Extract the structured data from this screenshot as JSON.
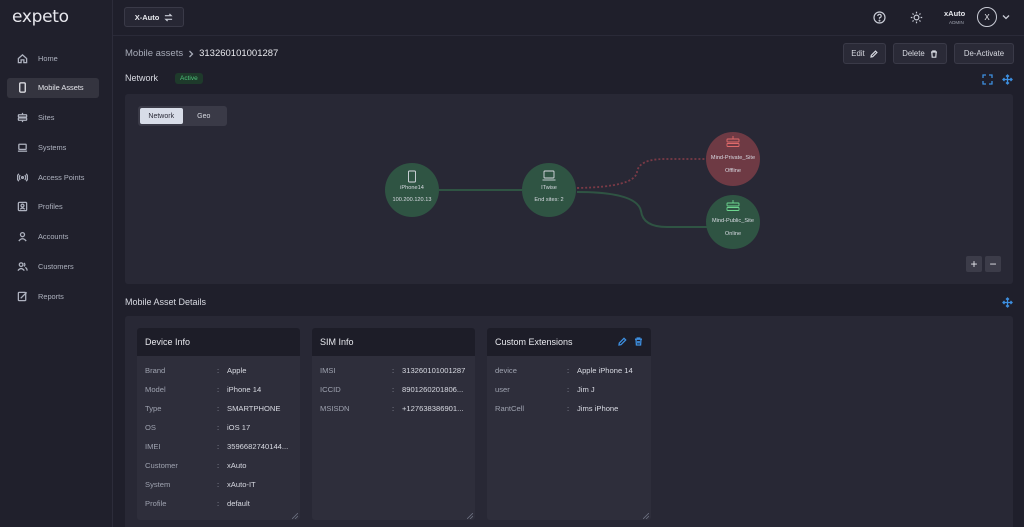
{
  "app": {
    "logo": "expeto"
  },
  "sidebar": {
    "items": [
      {
        "label": "Home",
        "icon": "home-icon"
      },
      {
        "label": "Mobile Assets",
        "icon": "phone-icon"
      },
      {
        "label": "Sites",
        "icon": "site-icon"
      },
      {
        "label": "Systems",
        "icon": "laptop-icon"
      },
      {
        "label": "Access Points",
        "icon": "antenna-icon"
      },
      {
        "label": "Profiles",
        "icon": "profile-icon"
      },
      {
        "label": "Accounts",
        "icon": "user-icon"
      },
      {
        "label": "Customers",
        "icon": "users-icon"
      },
      {
        "label": "Reports",
        "icon": "report-icon"
      }
    ],
    "active": "Mobile Assets"
  },
  "topbar": {
    "tenant": "X-Auto",
    "user_name": "xAuto",
    "user_role": "ADMIN",
    "avatar_letter": "X"
  },
  "header": {
    "breadcrumb_parent": "Mobile assets",
    "breadcrumb_current": "313260101001287",
    "edit_label": "Edit",
    "delete_label": "Delete",
    "deactivate_label": "De-Activate"
  },
  "network": {
    "title": "Network",
    "status": "Active",
    "toggle": {
      "network": "Network",
      "geo": "Geo",
      "selected": "Network"
    },
    "nodes": {
      "device": {
        "name": "iPhone14",
        "detail": "100.200.120.13"
      },
      "hub": {
        "name": "ITwise",
        "detail": "End sites: 2"
      },
      "site_private": {
        "name": "Mind-Private_Site",
        "detail": "Offline"
      },
      "site_public": {
        "name": "Mind-Public_Site",
        "detail": "Online"
      }
    },
    "zoom_in": "+",
    "zoom_out": "−"
  },
  "details": {
    "title": "Mobile Asset Details",
    "device_info": {
      "title": "Device Info",
      "rows": [
        {
          "key": "Brand",
          "value": "Apple"
        },
        {
          "key": "Model",
          "value": "iPhone 14"
        },
        {
          "key": "Type",
          "value": "SMARTPHONE"
        },
        {
          "key": "OS",
          "value": "iOS 17"
        },
        {
          "key": "IMEI",
          "value": "3596682740144..."
        },
        {
          "key": "Customer",
          "value": "xAuto"
        },
        {
          "key": "System",
          "value": "xAuto-IT"
        },
        {
          "key": "Profile",
          "value": "default"
        }
      ]
    },
    "sim_info": {
      "title": "SIM Info",
      "rows": [
        {
          "key": "IMSI",
          "value": "313260101001287"
        },
        {
          "key": "ICCID",
          "value": "8901260201806..."
        },
        {
          "key": "MSISDN",
          "value": "+127638386901..."
        }
      ]
    },
    "custom_extensions": {
      "title": "Custom Extensions",
      "rows": [
        {
          "key": "device",
          "value": "Apple iPhone 14"
        },
        {
          "key": "user",
          "value": "Jim J"
        },
        {
          "key": "RantCell",
          "value": "Jims iPhone"
        }
      ]
    },
    "separator": ":"
  },
  "colors": {
    "accent": "#3d8fe0",
    "online_node": "#2f5443",
    "offline_node": "#6e3a44",
    "active_badge": "#4cc27a"
  }
}
